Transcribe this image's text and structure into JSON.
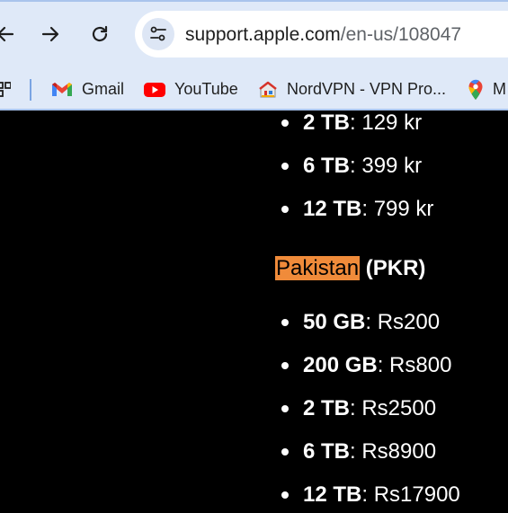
{
  "browser": {
    "url_domain": "support.apple.com",
    "url_path": "/en-us/108047",
    "bookmarks": [
      {
        "label": "Gmail",
        "icon": "gmail-icon"
      },
      {
        "label": "YouTube",
        "icon": "youtube-icon"
      },
      {
        "label": "NordVPN - VPN Pro...",
        "icon": "nordvpn-icon"
      },
      {
        "label": "M",
        "icon": "maps-icon"
      }
    ],
    "colors": {
      "toolbar": "#dfe9f8",
      "highlight": "#f08b3a"
    }
  },
  "content": {
    "previous_list": [
      {
        "size": "2 TB",
        "price": ": 129 kr"
      },
      {
        "size": "6 TB",
        "price": ": 399 kr"
      },
      {
        "size": "12 TB",
        "price": ": 799 kr"
      }
    ],
    "country": {
      "name": "Pakistan",
      "currency": " (PKR)"
    },
    "pakistan_list": [
      {
        "size": "50 GB",
        "price": ": Rs200"
      },
      {
        "size": "200 GB",
        "price": ": Rs800"
      },
      {
        "size": "2 TB",
        "price": ": Rs2500"
      },
      {
        "size": "6 TB",
        "price": ": Rs8900"
      },
      {
        "size": "12 TB",
        "price": ": Rs17900"
      }
    ]
  }
}
